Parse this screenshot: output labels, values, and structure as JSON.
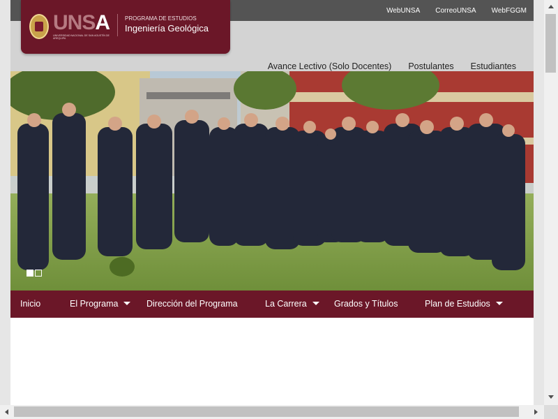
{
  "top_links": [
    "WebUNSA",
    "CorreoUNSA",
    "WebFGGM"
  ],
  "brand": {
    "logo_prefix": "UNS",
    "logo_suffix": "A",
    "logo_subtitle": "UNIVERSIDAD NACIONAL DE SAN AGUSTÍN DE AREQUIPA",
    "program_label": "PROGRAMA DE ESTUDIOS",
    "program_name": "Ingeniería Geológica"
  },
  "main_nav": [
    "Avance Lectivo (Solo Docentes)",
    "Postulantes",
    "Estudiantes"
  ],
  "hero": {
    "image": "group-photo",
    "slide_count": 2,
    "active_slide": 1
  },
  "menu": [
    {
      "label": "Inicio"
    },
    {
      "label": "El Programa",
      "dropdown": true
    },
    {
      "label": "Dirección del Programa"
    },
    {
      "label": "La Carrera",
      "dropdown": true
    },
    {
      "label": "Grados y Títulos"
    },
    {
      "label": "Plan de Estudios",
      "dropdown": true
    }
  ],
  "colors": {
    "brand": "#6b1728",
    "topbar": "#545454",
    "header": "#d3d3d3"
  }
}
